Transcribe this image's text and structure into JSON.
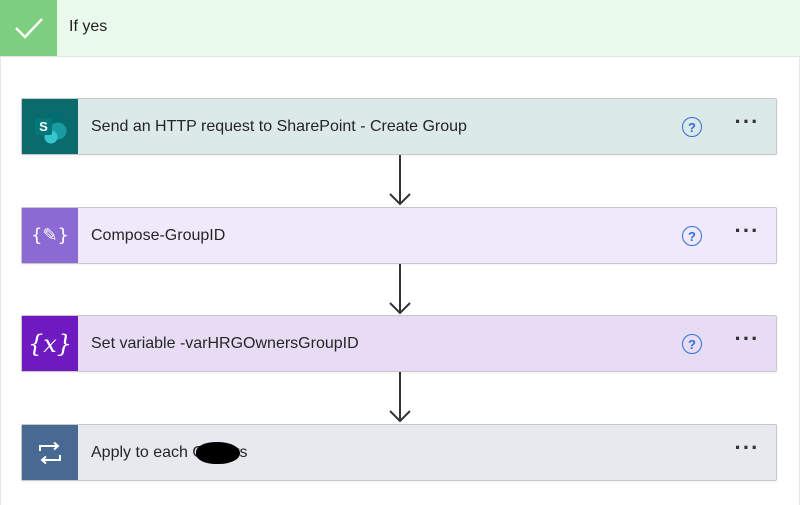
{
  "branch": {
    "title": "If yes",
    "header_color": "#eafaea",
    "check_color": "#7fcf81",
    "icon": "checkmark-icon"
  },
  "actions": [
    {
      "title": "Send an HTTP request to SharePoint - Create Group",
      "icon": "sharepoint-icon",
      "accent": "#0b6a6b",
      "background": "#dbe9e8",
      "has_help": true,
      "help_glyph": "?",
      "more_glyph": "···"
    },
    {
      "title": "Compose-GroupID",
      "icon": "compose-icon",
      "accent": "#8b6ad4",
      "background": "#efe9fb",
      "has_help": true,
      "help_glyph": "?",
      "more_glyph": "···"
    },
    {
      "title": "Set variable -varHRGOwnersGroupID",
      "icon": "variable-icon",
      "accent": "#6f19c1",
      "background": "#e8dcf5",
      "has_help": true,
      "help_glyph": "?",
      "more_glyph": "···"
    },
    {
      "title": "Apply to each Owners",
      "icon": "loop-icon",
      "accent": "#486991",
      "background": "#e6eaef",
      "has_help": false,
      "more_glyph": "···"
    }
  ],
  "connector_icon": "arrow-down-icon",
  "icon_glyphs": {
    "compose": "{✎}",
    "variable": "{x}",
    "sharepoint": "S"
  }
}
